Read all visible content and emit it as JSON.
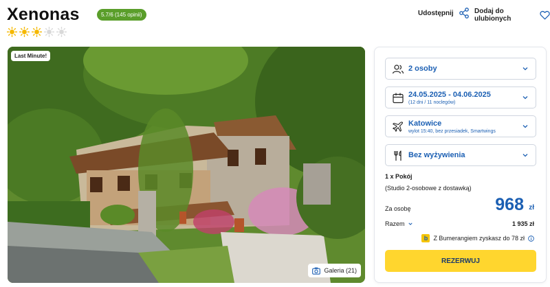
{
  "hotel": {
    "name": "Xenonas",
    "rating_badge": "5.7/6 (145 opinii)",
    "stars": [
      true,
      true,
      true,
      false,
      false
    ]
  },
  "actions": {
    "share_label": "Udostępnij",
    "favorite_label": "Dodaj do ulubionych"
  },
  "photo": {
    "badge": "Last Minute!",
    "gallery_label": "Galeria (21)"
  },
  "booking": {
    "guests": "2 osoby",
    "dates": "24.05.2025 - 04.06.2025",
    "duration": "(12 dni / 11 noclegów)",
    "departure_city": "Katowice",
    "flight_info": "wylot 15:40, bez przesiadek, Smartwings",
    "board": "Bez wyżywienia",
    "rooms": "1 x Pokój",
    "room_type": "(Studio 2-osobowe z dostawką)",
    "per_person_label": "Za osobę",
    "price": "968",
    "currency": "zł",
    "total_label": "Razem",
    "total_value": "1 935 zł",
    "bumerang_text": "Z Bumerangiem zyskasz do 78 zł",
    "reserve_label": "REZERWUJ"
  },
  "colors": {
    "brand_blue": "#1b5fb3",
    "badge_green": "#5a9e2a",
    "reserve_yellow": "#ffd62e",
    "star_active": "#f5b800",
    "star_inactive": "#d9d9d9"
  }
}
